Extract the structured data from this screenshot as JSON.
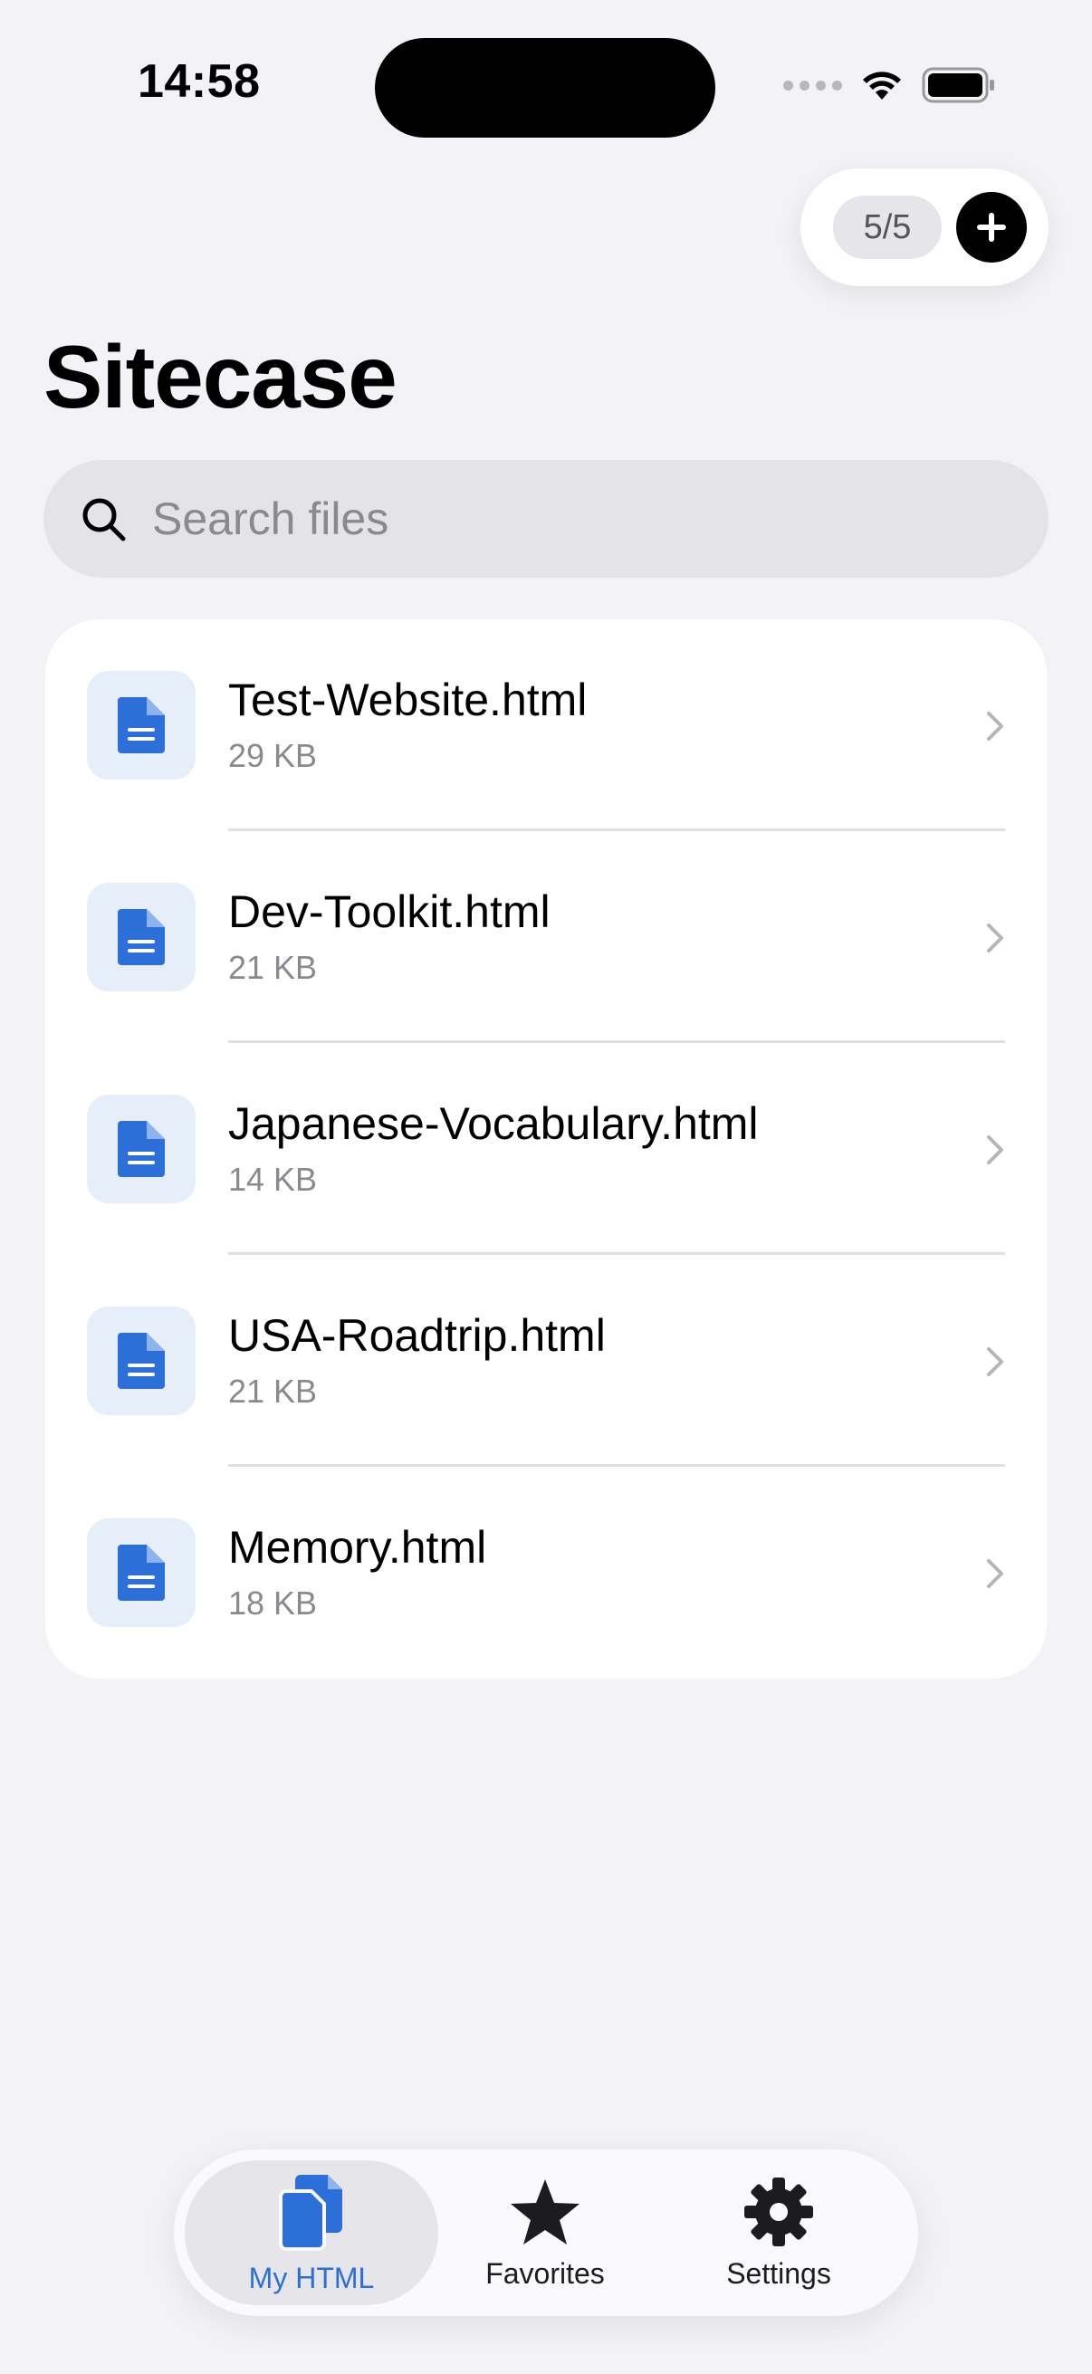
{
  "status_bar": {
    "time": "14:58"
  },
  "header": {
    "file_count": "5/5",
    "title": "Sitecase"
  },
  "search": {
    "placeholder": "Search files",
    "value": ""
  },
  "files": [
    {
      "name": "Test-Website.html",
      "size": "29 KB"
    },
    {
      "name": "Dev-Toolkit.html",
      "size": "21 KB"
    },
    {
      "name": "Japanese-Vocabulary.html",
      "size": "14 KB"
    },
    {
      "name": "USA-Roadtrip.html",
      "size": "21 KB"
    },
    {
      "name": "Memory.html",
      "size": "18 KB"
    }
  ],
  "tab_bar": {
    "tabs": [
      {
        "label": "My HTML",
        "icon": "documents-icon",
        "active": true
      },
      {
        "label": "Favorites",
        "icon": "star-icon",
        "active": false
      },
      {
        "label": "Settings",
        "icon": "gear-icon",
        "active": false
      }
    ]
  },
  "colors": {
    "accent": "#2c6fd8",
    "background": "#f2f2f7",
    "icon_bg": "#e6eefa"
  }
}
